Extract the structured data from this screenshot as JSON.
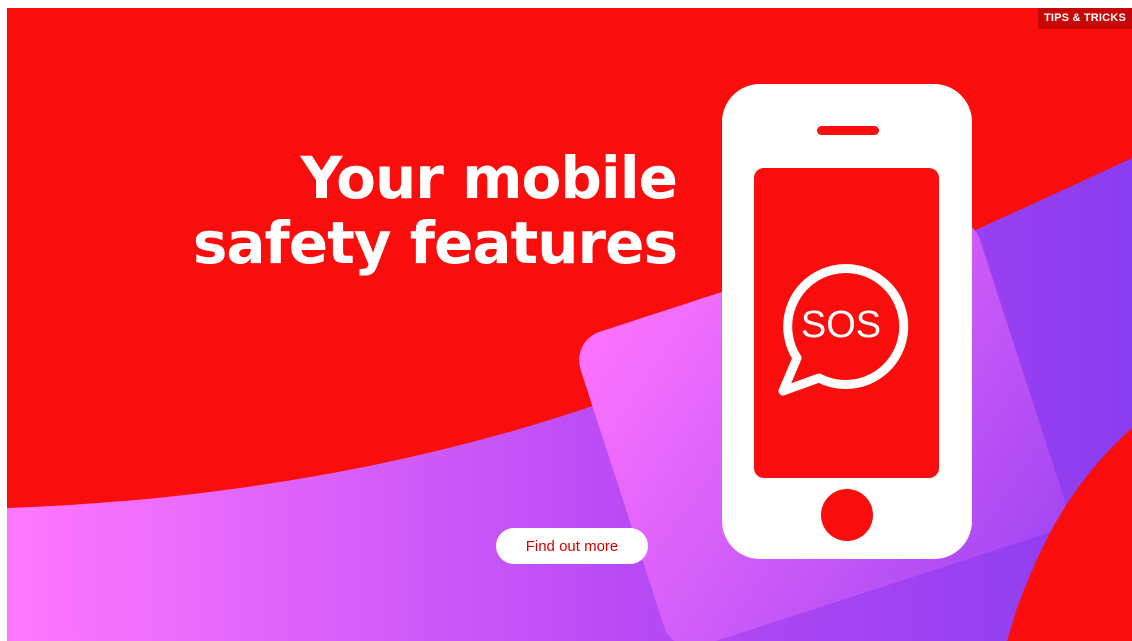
{
  "banner": {
    "tag_label": "TIPS & TRICKS",
    "headline_line1": "Your mobile",
    "headline_line2": "safety features",
    "cta_label": "Find out more",
    "phone_badge_text": "SOS"
  },
  "icons": [
    "phone-icon",
    "sos-chat-bubble-icon"
  ],
  "colors": {
    "brand_red": "#f90d0d",
    "wave_pink": "#ff78ff",
    "wave_purple": "#8a3cf0",
    "cta_text": "#d40000"
  }
}
